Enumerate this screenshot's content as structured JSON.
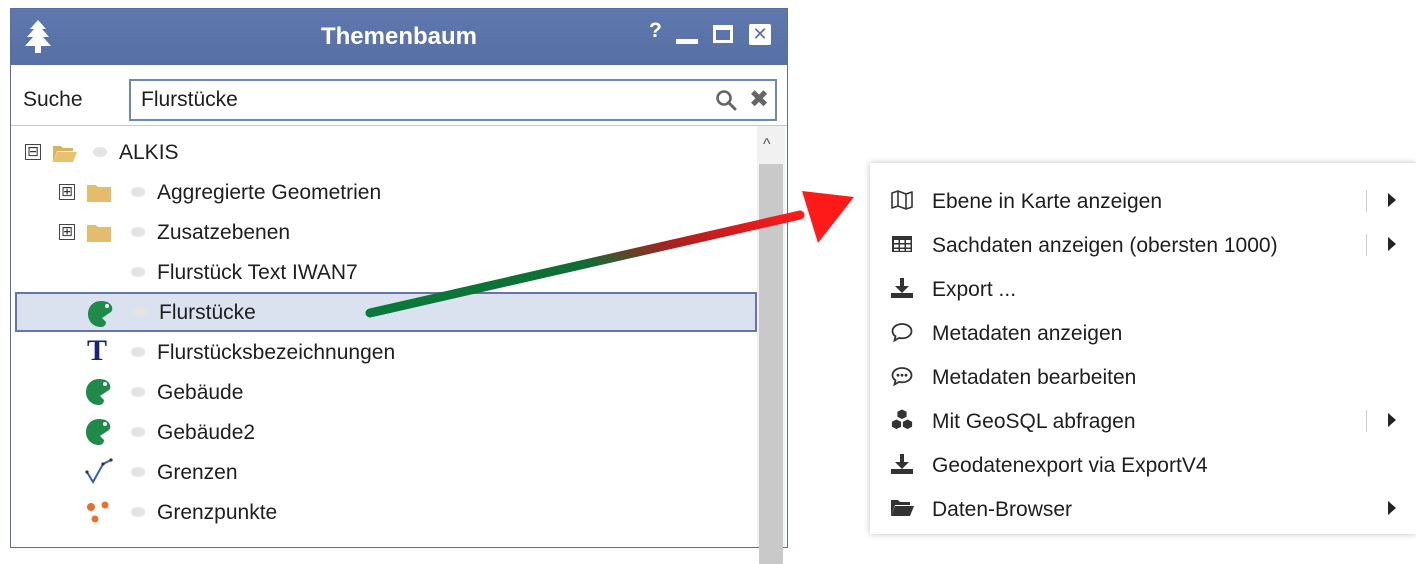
{
  "window": {
    "title": "Themenbaum",
    "help_label": "?",
    "close_label": "✕"
  },
  "search": {
    "label": "Suche",
    "value": "Flurstücke",
    "clear_label": "✖"
  },
  "tree": {
    "items": [
      {
        "label": "ALKIS",
        "expander": "⊟"
      },
      {
        "label": "Aggregierte Geometrien",
        "expander": "⊞"
      },
      {
        "label": "Zusatzebenen",
        "expander": "⊞"
      },
      {
        "label": "Flurstück Text IWAN7"
      },
      {
        "label": "Flurstücke",
        "selected": true
      },
      {
        "label": "Flurstücksbezeichnungen",
        "icon_text": "T"
      },
      {
        "label": "Gebäude"
      },
      {
        "label": "Gebäude2"
      },
      {
        "label": "Grenzen"
      },
      {
        "label": "Grenzpunkte"
      }
    ]
  },
  "context_menu": {
    "items": [
      {
        "label": "Ebene in Karte anzeigen",
        "icon": "map-icon"
      },
      {
        "label": "Sachdaten anzeigen (obersten 1000)",
        "icon": "table-icon"
      },
      {
        "label": "Export ...",
        "icon": "download-icon"
      },
      {
        "label": "Metadaten anzeigen",
        "icon": "comment-icon"
      },
      {
        "label": "Metadaten bearbeiten",
        "icon": "comment-dots-icon"
      },
      {
        "label": "Mit GeoSQL abfragen",
        "icon": "cubes-icon"
      },
      {
        "label": "Geodatenexport via ExportV4",
        "icon": "download-icon"
      },
      {
        "label": "Daten-Browser",
        "icon": "folder-open-icon"
      }
    ]
  },
  "colors": {
    "titlebar": "#5670a6",
    "selection": "#dbe2ef",
    "arrow_start": "#0a7a3a",
    "arrow_end": "#ff1a1a"
  }
}
